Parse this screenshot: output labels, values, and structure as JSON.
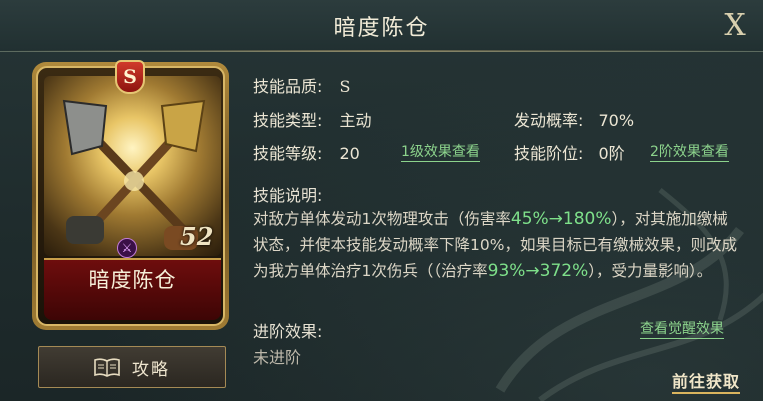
{
  "header": {
    "title": "暗度陈仓",
    "close_label": "X"
  },
  "card": {
    "grade": "S",
    "name": "暗度陈仓",
    "level_mark": "52"
  },
  "guide_button": {
    "label": "攻略",
    "icon": "book-icon"
  },
  "info": {
    "quality_label": "技能品质:",
    "quality_value": "S",
    "type_label": "技能类型:",
    "type_value": "主动",
    "chance_label": "发动概率:",
    "chance_value": "70%",
    "level_label": "技能等级:",
    "level_value": "20",
    "level_effect_link": "1级效果查看",
    "tier_label": "技能阶位:",
    "tier_value": "0阶",
    "tier_effect_link": "2阶效果查看"
  },
  "description": {
    "label": "技能说明:",
    "part1": "对敌方单体发动1次物理攻击（伤害率",
    "hl1": "45%→180%",
    "part2": "），对其施加缴械状态，并使本技能发动概率下降10%，如果目标已有缴械效果，则改成为我方单体治疗1次伤兵（（治疗率",
    "hl2": "93%→372%",
    "part3": "），受力量影响）。"
  },
  "advance": {
    "label": "进阶效果:",
    "value": "未进阶",
    "awaken_link": "查看觉醒效果"
  },
  "acquire_link": "前往获取",
  "colors": {
    "highlight": "#7ee08a",
    "link": "#8cd38c",
    "gold": "#d9b45e"
  }
}
